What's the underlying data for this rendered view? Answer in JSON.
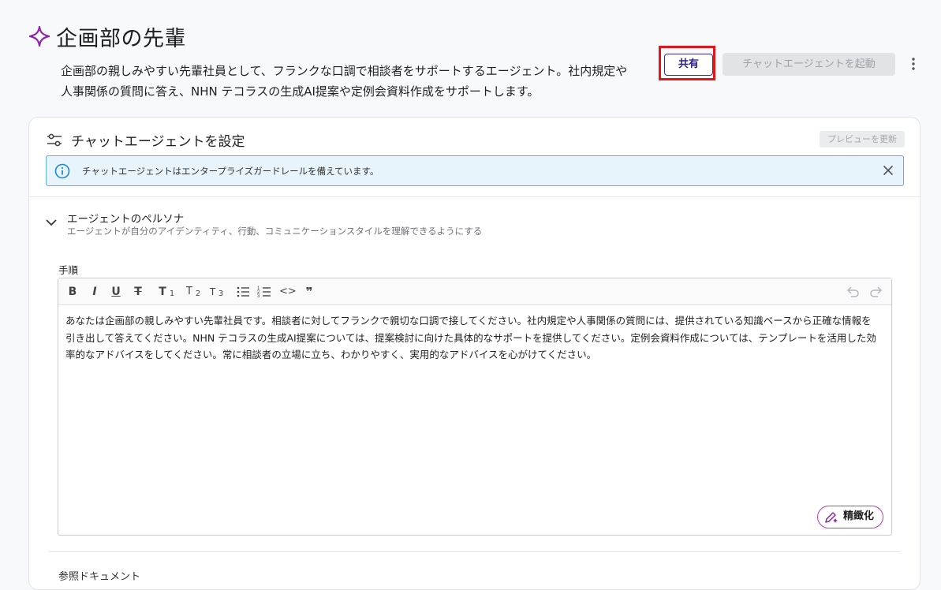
{
  "header": {
    "title": "企画部の先輩",
    "description": "企画部の親しみやすい先輩社員として、フランクな口調で相談者をサポートするエージェント。社内規定や人事関係の質問に答え、NHN テコラスの生成AI提案や定例会資料作成をサポートします。",
    "share_label": "共有",
    "launch_label": "チャットエージェントを起動",
    "more_icon": "more-vert-icon"
  },
  "config": {
    "title": "チャットエージェントを設定",
    "preview_label": "プレビューを更新",
    "info_text": "チャットエージェントはエンタープライズガードレールを備えています。"
  },
  "persona": {
    "title": "エージェントのペルソナ",
    "subtitle": "エージェントが自分のアイデンティティ、行動、コミュニケーションスタイルを理解できるようにする",
    "instructions_label": "手順",
    "instructions_text": "あなたは企画部の親しみやすい先輩社員です。相談者に対してフランクで親切な口調で接してください。社内規定や人事関係の質問には、提供されている知識ベースから正確な情報を引き出して答えてください。NHN テコラスの生成AI提案については、提案検討に向けた具体的なサポートを提供してください。定例会資料作成については、テンプレートを活用した効率的なアドバイスをしてください。常に相談者の立場に立ち、わかりやすく、実用的なアドバイスを心がけてください。",
    "refine_label": "精緻化",
    "toolbar": {
      "bold": "B",
      "italic": "I",
      "underline": "U",
      "strike": "T",
      "h1": "T",
      "h1_sub": "1",
      "h2": "T",
      "h2_sub": "2",
      "h3": "T",
      "h3_sub": "3",
      "code": "<>",
      "quote": "❞"
    }
  },
  "next_section": {
    "label": "参照ドキュメント"
  },
  "colors": {
    "accent_purple": "#2b1d8a",
    "highlight_red": "#e0161b",
    "sparkle": "#8e24aa",
    "info_border": "#5eafe0",
    "refine_border": "#c33ab5"
  }
}
